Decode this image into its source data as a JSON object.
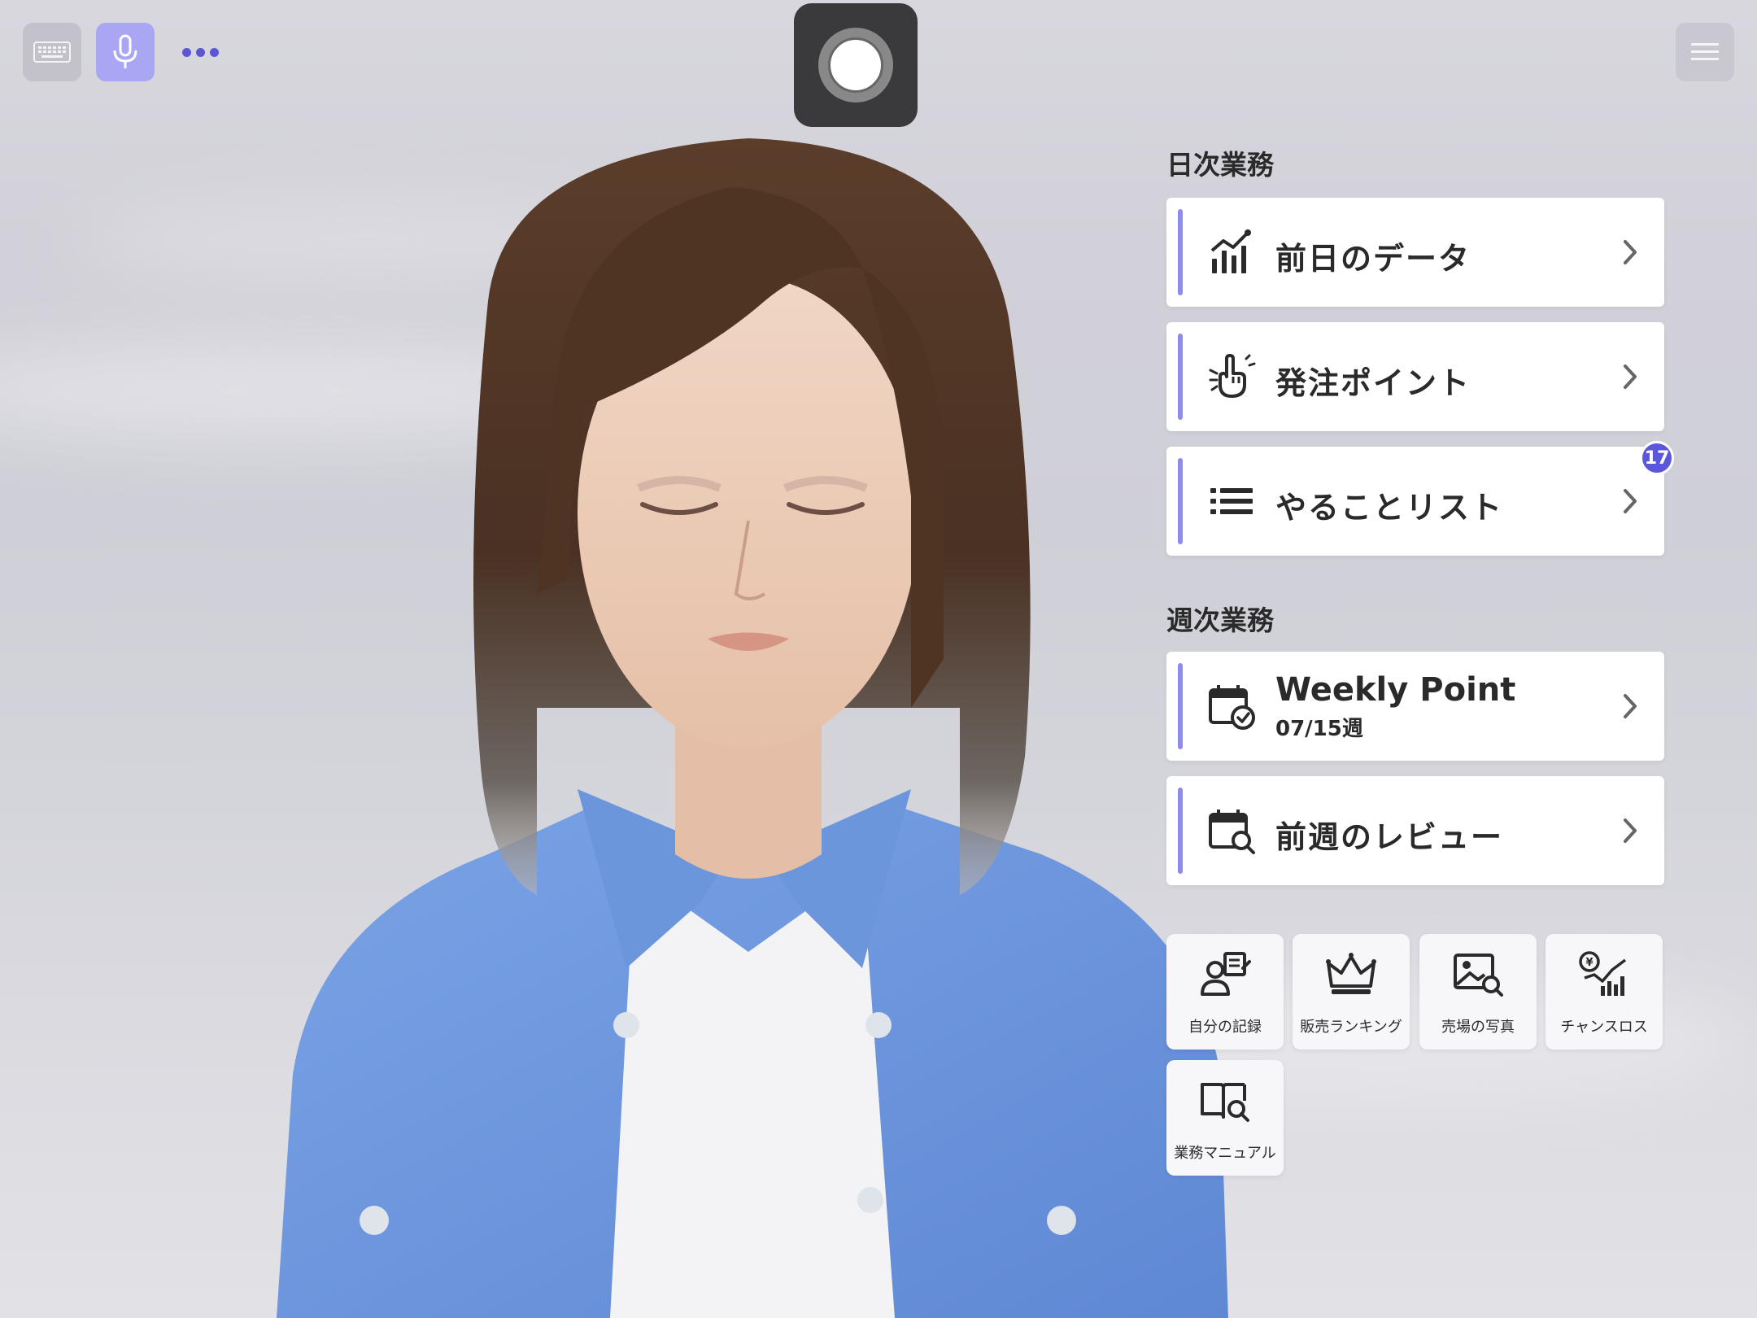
{
  "top_bar": {
    "keyboard_icon": "keyboard-icon",
    "mic_icon": "microphone-icon",
    "more_icon": "more-dots-icon",
    "record_icon": "record-icon",
    "menu_icon": "hamburger-menu-icon"
  },
  "daily": {
    "title": "日次業務",
    "items": [
      {
        "label": "前日のデータ",
        "icon": "bar-chart-trend-icon"
      },
      {
        "label": "発注ポイント",
        "icon": "hand-point-icon"
      },
      {
        "label": "やることリスト",
        "icon": "list-icon",
        "badge": "17"
      }
    ]
  },
  "weekly": {
    "title": "週次業務",
    "items": [
      {
        "label": "Weekly Point",
        "sublabel": "07/15週",
        "icon": "calendar-check-icon"
      },
      {
        "label": "前週のレビュー",
        "icon": "calendar-search-icon"
      }
    ]
  },
  "tiles": [
    {
      "label": "自分の記録",
      "icon": "user-record-icon"
    },
    {
      "label": "販売ランキング",
      "icon": "crown-icon"
    },
    {
      "label": "売場の写真",
      "icon": "photo-search-icon"
    },
    {
      "label": "チャンスロス",
      "icon": "yen-chart-icon"
    },
    {
      "label": "業務マニュアル",
      "icon": "book-search-icon"
    }
  ],
  "colors": {
    "accent": "#8f8bea",
    "badge": "#5b57db",
    "mic_button": "#a9a7f4",
    "shirt": "#6f98de"
  }
}
